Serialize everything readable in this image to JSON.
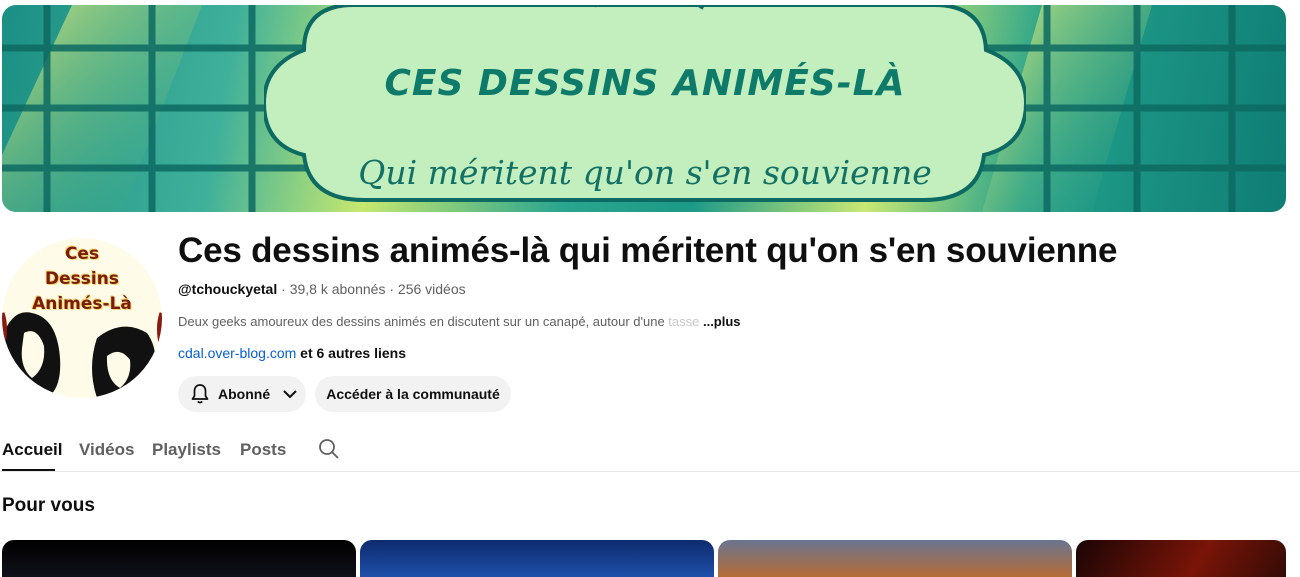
{
  "banner": {
    "title": "CES DESSINS ANIMÉS-LÀ",
    "subtitle": "Qui méritent qu'on s'en souvienne"
  },
  "avatar": {
    "line1": "Ces",
    "line2": "Dessins",
    "line3": "Animés-Là"
  },
  "channel": {
    "name": "Ces dessins animés-là qui méritent qu'on s'en souvienne",
    "handle": "@tchouckyetal",
    "subscribers": "39,8 k abonnés",
    "videos": "256 vidéos",
    "separator": " · ",
    "description": "Deux geeks amoureux des dessins animés en discutent sur un canapé, autour d'une",
    "description_fade": " tasse ",
    "more": "...plus",
    "link": "cdal.over-blog.com",
    "other_links": " et 6 autres liens"
  },
  "buttons": {
    "subscribed": "Abonné",
    "community": "Accéder à la communauté"
  },
  "tabs": [
    "Accueil",
    "Vidéos",
    "Playlists",
    "Posts"
  ],
  "section": {
    "title": "Pour vous"
  },
  "icons": {
    "bell": "bell-icon",
    "chevron": "chevron-down-icon",
    "search": "search-icon"
  }
}
